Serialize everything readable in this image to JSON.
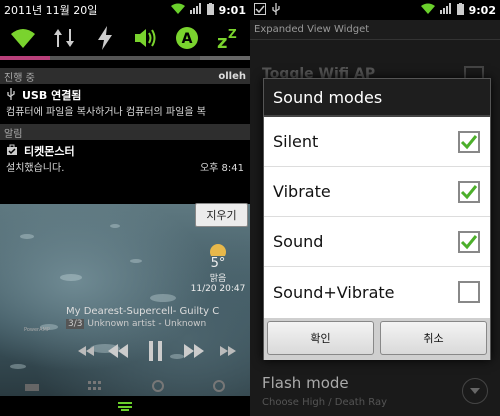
{
  "left": {
    "status": {
      "date": "2011년 11월 20일",
      "time": "9:01"
    },
    "ongoing": {
      "header": "진행 중",
      "carrier": "olleh"
    },
    "usb": {
      "title": "USB 연결됨",
      "text": "컴퓨터에 파일을 복사하거나 컴퓨터의 파일을 복"
    },
    "alerts": {
      "header": "알림"
    },
    "ticket": {
      "title": "티켓몬스터",
      "text": "설치했습니다.",
      "time": "오후 8:41"
    },
    "clear_label": "지우기",
    "weather": {
      "temp": "5°",
      "cond": "맑음",
      "updated": "11/20 20:47"
    },
    "music": {
      "title": "My Dearest-Supercell- Guilty C",
      "track": "3/3",
      "artist": "Unknown artist - Unknown"
    },
    "accent": "#b8407a"
  },
  "right": {
    "status": {
      "time": "9:02"
    },
    "widget_header": "Expanded View Widget",
    "bg_row": "Toggle Wifi AP",
    "dialog": {
      "title": "Sound modes",
      "options": [
        {
          "label": "Silent",
          "checked": true
        },
        {
          "label": "Vibrate",
          "checked": true
        },
        {
          "label": "Sound",
          "checked": true
        },
        {
          "label": "Sound+Vibrate",
          "checked": false
        }
      ],
      "ok": "확인",
      "cancel": "취소"
    },
    "flash": {
      "title": "Flash mode",
      "sub": "Choose High / Death Ray"
    },
    "check_color": "#4caf2a"
  }
}
